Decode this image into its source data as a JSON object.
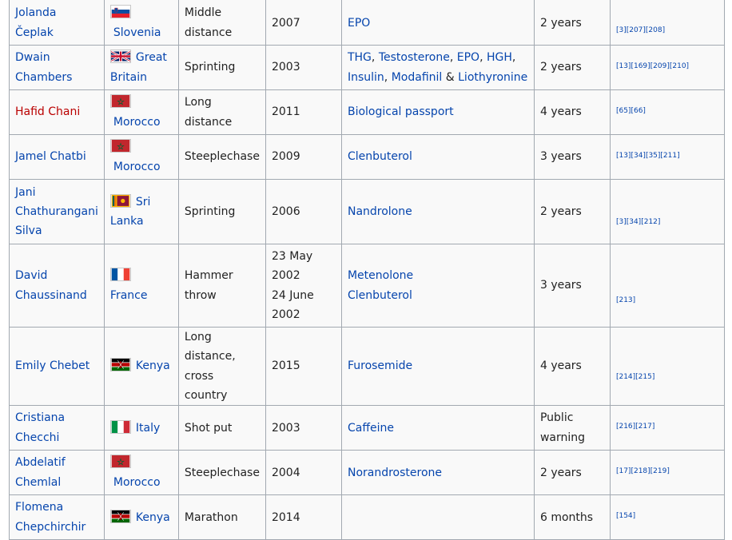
{
  "rows": [
    {
      "athlete": [
        "Jolanda",
        "Čeplak"
      ],
      "athlete_link": "existing",
      "flag_icon": "flag-slovenia-icon",
      "country": "Slovenia",
      "event": [
        "Middle",
        "distance"
      ],
      "date": [
        "2007"
      ],
      "substances": [
        {
          "text": "EPO",
          "sep": ""
        }
      ],
      "sanction": [
        "2 years"
      ],
      "refs": [
        "[3]",
        "[207]",
        "[208]"
      ]
    },
    {
      "athlete": [
        "Dwain",
        "Chambers"
      ],
      "athlete_link": "existing",
      "flag_icon": "flag-great-britain-icon",
      "country": "Great Britain",
      "event": [
        "Sprinting"
      ],
      "date": [
        "2003"
      ],
      "substances": [
        {
          "text": "THG",
          "sep": ", "
        },
        {
          "text": "Testosterone",
          "sep": ", "
        },
        {
          "text": "EPO",
          "sep": ", "
        },
        {
          "text": "HGH",
          "sep": ","
        },
        {
          "text": "Insulin",
          "sep": ", "
        },
        {
          "text": "Modafinil",
          "sep": " & "
        },
        {
          "text": "Liothyronine",
          "sep": ""
        }
      ],
      "sanction": [
        "2 years"
      ],
      "refs": [
        "[13]",
        "[169]",
        "[209]",
        "[210]"
      ]
    },
    {
      "athlete": [
        "Hafid Chani"
      ],
      "athlete_link": "missing",
      "flag_icon": "flag-morocco-icon",
      "country": "Morocco",
      "event": [
        "Long",
        "distance"
      ],
      "date": [
        "2011"
      ],
      "substances": [
        {
          "text": "Biological passport",
          "sep": ""
        }
      ],
      "sanction": [
        "4 years"
      ],
      "refs": [
        "[65]",
        "[66]"
      ]
    },
    {
      "athlete": [
        "Jamel Chatbi"
      ],
      "athlete_link": "existing",
      "flag_icon": "flag-morocco-icon",
      "country": "Morocco",
      "event": [
        "Steeplechase"
      ],
      "date": [
        "2009"
      ],
      "substances": [
        {
          "text": "Clenbuterol",
          "sep": ""
        }
      ],
      "sanction": [
        "3 years"
      ],
      "refs": [
        "[13]",
        "[34]",
        "[35]",
        "[211]"
      ]
    },
    {
      "athlete": [
        "Jani",
        "Chathurangani",
        "Silva"
      ],
      "athlete_link": "existing",
      "flag_icon": "flag-sri-lanka-icon",
      "country": "Sri Lanka",
      "event": [
        "Sprinting"
      ],
      "date": [
        "2006"
      ],
      "substances": [
        {
          "text": "Nandrolone",
          "sep": ""
        }
      ],
      "sanction": [
        "2 years"
      ],
      "refs": [
        "[3]",
        "[34]",
        "[212]"
      ]
    },
    {
      "athlete": [
        "David",
        "Chaussinand"
      ],
      "athlete_link": "existing",
      "flag_icon": "flag-france-icon",
      "country": "France",
      "event": [
        "Hammer",
        "throw"
      ],
      "date": [
        "23 May",
        "2002",
        "24 June",
        "2002"
      ],
      "substances": [
        {
          "text": "Metenolone",
          "sep": ""
        },
        {
          "text": "Clenbuterol",
          "sep": ""
        }
      ],
      "substances_stacked": true,
      "sanction": [
        "3 years"
      ],
      "refs": [
        "[213]"
      ]
    },
    {
      "athlete": [
        "Emily Chebet"
      ],
      "athlete_link": "existing",
      "flag_icon": "flag-kenya-icon",
      "country": "Kenya",
      "event": [
        "Long",
        "distance,",
        "cross country"
      ],
      "date": [
        "2015"
      ],
      "substances": [
        {
          "text": "Furosemide",
          "sep": ""
        }
      ],
      "sanction": [
        "4 years"
      ],
      "refs": [
        "[214]",
        "[215]"
      ]
    },
    {
      "athlete": [
        "Cristiana",
        "Checchi"
      ],
      "athlete_link": "existing",
      "flag_icon": "flag-italy-icon",
      "country": "Italy",
      "event": [
        "Shot put"
      ],
      "date": [
        "2003"
      ],
      "substances": [
        {
          "text": "Caffeine",
          "sep": ""
        }
      ],
      "sanction": [
        "Public",
        "warning"
      ],
      "refs": [
        "[216]",
        "[217]"
      ]
    },
    {
      "athlete": [
        "Abdelatif",
        "Chemlal"
      ],
      "athlete_link": "existing",
      "flag_icon": "flag-morocco-icon",
      "country": "Morocco",
      "event": [
        "Steeplechase"
      ],
      "date": [
        "2004"
      ],
      "substances": [
        {
          "text": "Norandrosterone",
          "sep": ""
        }
      ],
      "sanction": [
        "2 years"
      ],
      "refs": [
        "[17]",
        "[218]",
        "[219]"
      ]
    },
    {
      "athlete": [
        "Flomena",
        "Chepchirchir"
      ],
      "athlete_link": "existing",
      "flag_icon": "flag-kenya-icon",
      "country": "Kenya",
      "event": [
        "Marathon"
      ],
      "date": [
        "2014"
      ],
      "substances": [],
      "sanction": [
        "6 months"
      ],
      "refs": [
        "[154]"
      ]
    }
  ],
  "colors": {
    "link": "#0645ad",
    "missing_link": "#ba0000",
    "border": "#a2a9b1",
    "table_bg": "#f9f9f9"
  }
}
